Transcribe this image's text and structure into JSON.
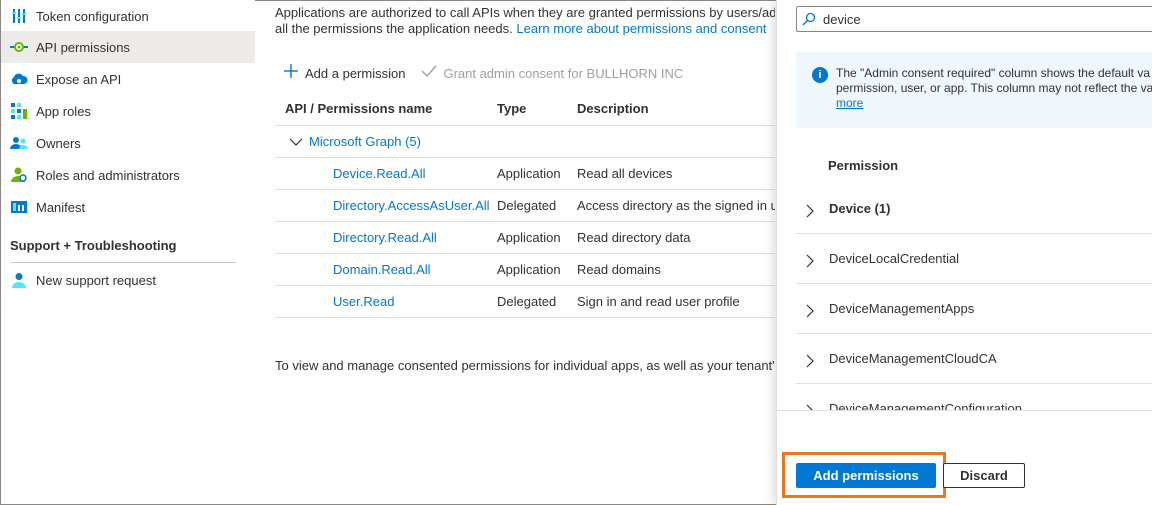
{
  "sidebar": {
    "items": [
      {
        "label": "Token configuration",
        "icon": "token-configuration-icon"
      },
      {
        "label": "API permissions",
        "icon": "api-permissions-icon",
        "active": true
      },
      {
        "label": "Expose an API",
        "icon": "cloud-icon"
      },
      {
        "label": "App roles",
        "icon": "app-roles-icon"
      },
      {
        "label": "Owners",
        "icon": "owners-icon"
      },
      {
        "label": "Roles and administrators",
        "icon": "roles-admin-icon"
      },
      {
        "label": "Manifest",
        "icon": "manifest-icon"
      }
    ],
    "support_title": "Support + Troubleshooting",
    "support_items": [
      {
        "label": "New support request",
        "icon": "support-person-icon"
      }
    ]
  },
  "main": {
    "intro_line1": "Applications are authorized to call APIs when they are granted permissions by users/adr",
    "intro_line2_prefix": "all the permissions the application needs. ",
    "intro_link": "Learn more about permissions and consent",
    "toolbar": {
      "add_label": "Add a permission",
      "grant_label": "Grant admin consent for BULLHORN INC"
    },
    "table": {
      "headers": [
        "API / Permissions name",
        "Type",
        "Description"
      ],
      "group": "Microsoft Graph (5)",
      "rows": [
        {
          "name": "Device.Read.All",
          "type": "Application",
          "description": "Read all devices"
        },
        {
          "name": "Directory.AccessAsUser.All",
          "type": "Delegated",
          "description": "Access directory as the signed in u"
        },
        {
          "name": "Directory.Read.All",
          "type": "Application",
          "description": "Read directory data"
        },
        {
          "name": "Domain.Read.All",
          "type": "Application",
          "description": "Read domains"
        },
        {
          "name": "User.Read",
          "type": "Delegated",
          "description": "Sign in and read user profile"
        }
      ]
    },
    "outro": "To view and manage consented permissions for individual apps, as well as your tenant's"
  },
  "panel": {
    "search_value": "device",
    "info_line1": "The \"Admin consent required\" column shows the default va",
    "info_line2": "permission, user, or app. This column may not reflect the va",
    "info_link": "more",
    "permission_header": "Permission",
    "permissions": [
      {
        "label": "Device (1)",
        "bold": true
      },
      {
        "label": "DeviceLocalCredential",
        "bold": false
      },
      {
        "label": "DeviceManagementApps",
        "bold": false
      },
      {
        "label": "DeviceManagementCloudCA",
        "bold": false
      },
      {
        "label": "DeviceManagementConfiguration",
        "bold": false
      }
    ],
    "add_button": "Add permissions",
    "discard_button": "Discard"
  },
  "colors": {
    "accent": "#0078d4",
    "highlight": "#e8781f",
    "info_bg": "#eff6fc"
  }
}
